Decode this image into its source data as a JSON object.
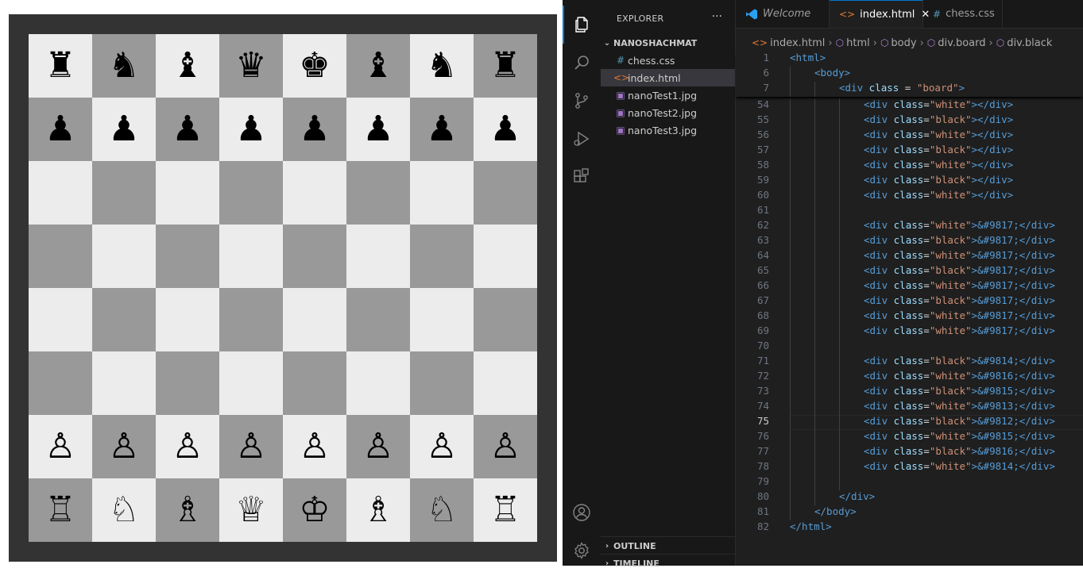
{
  "board": {
    "rows": [
      [
        {
          "p": "♜",
          "c": "white"
        },
        {
          "p": "♞",
          "c": "black"
        },
        {
          "p": "♝",
          "c": "white"
        },
        {
          "p": "♛",
          "c": "black"
        },
        {
          "p": "♚",
          "c": "white"
        },
        {
          "p": "♝",
          "c": "black"
        },
        {
          "p": "♞",
          "c": "white"
        },
        {
          "p": "♜",
          "c": "black"
        }
      ],
      [
        {
          "p": "♟",
          "c": "black"
        },
        {
          "p": "♟",
          "c": "white"
        },
        {
          "p": "♟",
          "c": "black"
        },
        {
          "p": "♟",
          "c": "white"
        },
        {
          "p": "♟",
          "c": "black"
        },
        {
          "p": "♟",
          "c": "white"
        },
        {
          "p": "♟",
          "c": "black"
        },
        {
          "p": "♟",
          "c": "white"
        }
      ],
      [
        {
          "p": "",
          "c": "white"
        },
        {
          "p": "",
          "c": "black"
        },
        {
          "p": "",
          "c": "white"
        },
        {
          "p": "",
          "c": "black"
        },
        {
          "p": "",
          "c": "white"
        },
        {
          "p": "",
          "c": "black"
        },
        {
          "p": "",
          "c": "white"
        },
        {
          "p": "",
          "c": "black"
        }
      ],
      [
        {
          "p": "",
          "c": "black"
        },
        {
          "p": "",
          "c": "white"
        },
        {
          "p": "",
          "c": "black"
        },
        {
          "p": "",
          "c": "white"
        },
        {
          "p": "",
          "c": "black"
        },
        {
          "p": "",
          "c": "white"
        },
        {
          "p": "",
          "c": "black"
        },
        {
          "p": "",
          "c": "white"
        }
      ],
      [
        {
          "p": "",
          "c": "white"
        },
        {
          "p": "",
          "c": "black"
        },
        {
          "p": "",
          "c": "white"
        },
        {
          "p": "",
          "c": "black"
        },
        {
          "p": "",
          "c": "white"
        },
        {
          "p": "",
          "c": "black"
        },
        {
          "p": "",
          "c": "white"
        },
        {
          "p": "",
          "c": "black"
        }
      ],
      [
        {
          "p": "",
          "c": "black"
        },
        {
          "p": "",
          "c": "white"
        },
        {
          "p": "",
          "c": "black"
        },
        {
          "p": "",
          "c": "white"
        },
        {
          "p": "",
          "c": "black"
        },
        {
          "p": "",
          "c": "white"
        },
        {
          "p": "",
          "c": "black"
        },
        {
          "p": "",
          "c": "white"
        }
      ],
      [
        {
          "p": "♙",
          "c": "white"
        },
        {
          "p": "♙",
          "c": "black"
        },
        {
          "p": "♙",
          "c": "white"
        },
        {
          "p": "♙",
          "c": "black"
        },
        {
          "p": "♙",
          "c": "white"
        },
        {
          "p": "♙",
          "c": "black"
        },
        {
          "p": "♙",
          "c": "white"
        },
        {
          "p": "♙",
          "c": "black"
        }
      ],
      [
        {
          "p": "♖",
          "c": "black"
        },
        {
          "p": "♘",
          "c": "white"
        },
        {
          "p": "♗",
          "c": "black"
        },
        {
          "p": "♕",
          "c": "white"
        },
        {
          "p": "♔",
          "c": "black"
        },
        {
          "p": "♗",
          "c": "white"
        },
        {
          "p": "♘",
          "c": "black"
        },
        {
          "p": "♖",
          "c": "white"
        }
      ]
    ]
  },
  "activity_bar": {
    "items": [
      {
        "icon": "files-icon",
        "active": true
      },
      {
        "icon": "search-icon",
        "active": false
      },
      {
        "icon": "source-control-icon",
        "active": false
      },
      {
        "icon": "run-debug-icon",
        "active": false
      },
      {
        "icon": "extensions-icon",
        "active": false
      }
    ],
    "bottom": [
      {
        "icon": "account-icon"
      },
      {
        "icon": "settings-gear-icon"
      }
    ]
  },
  "sidebar": {
    "title": "EXPLORER",
    "more": "···",
    "folder": "NANOSHACHMAT",
    "files": [
      {
        "name": "chess.css",
        "icon": "#",
        "color": "#519aba",
        "selected": false
      },
      {
        "name": "index.html",
        "icon": "<>",
        "color": "#e37933",
        "selected": true
      },
      {
        "name": "nanoTest1.jpg",
        "icon": "▣",
        "color": "#a074c4",
        "selected": false
      },
      {
        "name": "nanoTest2.jpg",
        "icon": "▣",
        "color": "#a074c4",
        "selected": false
      },
      {
        "name": "nanoTest3.jpg",
        "icon": "▣",
        "color": "#a074c4",
        "selected": false
      }
    ],
    "outline": "OUTLINE",
    "timeline": "TIMELINE"
  },
  "tabs": [
    {
      "label": "Welcome",
      "icon": "vscode-logo-icon",
      "active": false,
      "italic": true
    },
    {
      "label": "index.html",
      "icon": "<>",
      "active": true,
      "close": "✕"
    },
    {
      "label": "chess.css",
      "icon": "#",
      "active": false,
      "italic": false
    }
  ],
  "breadcrumb": [
    "index.html",
    "html",
    "body",
    "div.board",
    "div.black"
  ],
  "code": {
    "current_line": 75,
    "sticky": [
      {
        "n": 1,
        "indent": 0,
        "tokens": [
          [
            "tag",
            "<html>"
          ]
        ]
      },
      {
        "n": 6,
        "indent": 1,
        "tokens": [
          [
            "tag",
            "<body>"
          ]
        ]
      },
      {
        "n": 7,
        "indent": 2,
        "tokens": [
          [
            "tag",
            "<div "
          ],
          [
            "attr",
            "class "
          ],
          [
            "txt",
            "= "
          ],
          [
            "str",
            "\"board\""
          ],
          [
            "tag",
            ">"
          ]
        ]
      }
    ],
    "lines": [
      {
        "n": 54,
        "indent": 3,
        "tokens": [
          [
            "tag",
            "<div "
          ],
          [
            "attr",
            "class"
          ],
          [
            "txt",
            "="
          ],
          [
            "str",
            "\"white\""
          ],
          [
            "tag",
            "></div>"
          ]
        ]
      },
      {
        "n": 55,
        "indent": 3,
        "tokens": [
          [
            "tag",
            "<div "
          ],
          [
            "attr",
            "class"
          ],
          [
            "txt",
            "="
          ],
          [
            "str",
            "\"black\""
          ],
          [
            "tag",
            "></div>"
          ]
        ]
      },
      {
        "n": 56,
        "indent": 3,
        "tokens": [
          [
            "tag",
            "<div "
          ],
          [
            "attr",
            "class"
          ],
          [
            "txt",
            "="
          ],
          [
            "str",
            "\"white\""
          ],
          [
            "tag",
            "></div>"
          ]
        ]
      },
      {
        "n": 57,
        "indent": 3,
        "tokens": [
          [
            "tag",
            "<div "
          ],
          [
            "attr",
            "class"
          ],
          [
            "txt",
            "="
          ],
          [
            "str",
            "\"black\""
          ],
          [
            "tag",
            "></div>"
          ]
        ]
      },
      {
        "n": 58,
        "indent": 3,
        "tokens": [
          [
            "tag",
            "<div "
          ],
          [
            "attr",
            "class"
          ],
          [
            "txt",
            "="
          ],
          [
            "str",
            "\"white\""
          ],
          [
            "tag",
            "></div>"
          ]
        ]
      },
      {
        "n": 59,
        "indent": 3,
        "tokens": [
          [
            "tag",
            "<div "
          ],
          [
            "attr",
            "class"
          ],
          [
            "txt",
            "="
          ],
          [
            "str",
            "\"black\""
          ],
          [
            "tag",
            "></div>"
          ]
        ]
      },
      {
        "n": 60,
        "indent": 3,
        "tokens": [
          [
            "tag",
            "<div "
          ],
          [
            "attr",
            "class"
          ],
          [
            "txt",
            "="
          ],
          [
            "str",
            "\"white\""
          ],
          [
            "tag",
            "></div>"
          ]
        ]
      },
      {
        "n": 61,
        "indent": 3,
        "tokens": []
      },
      {
        "n": 62,
        "indent": 3,
        "tokens": [
          [
            "tag",
            "<div "
          ],
          [
            "attr",
            "class"
          ],
          [
            "txt",
            "="
          ],
          [
            "str",
            "\"white\""
          ],
          [
            "tag",
            ">"
          ],
          [
            "ent",
            "&#9817;"
          ],
          [
            "tag",
            "</div>"
          ]
        ]
      },
      {
        "n": 63,
        "indent": 3,
        "tokens": [
          [
            "tag",
            "<div "
          ],
          [
            "attr",
            "class"
          ],
          [
            "txt",
            "="
          ],
          [
            "str",
            "\"black\""
          ],
          [
            "tag",
            ">"
          ],
          [
            "ent",
            "&#9817;"
          ],
          [
            "tag",
            "</div>"
          ]
        ]
      },
      {
        "n": 64,
        "indent": 3,
        "tokens": [
          [
            "tag",
            "<div "
          ],
          [
            "attr",
            "class"
          ],
          [
            "txt",
            "="
          ],
          [
            "str",
            "\"white\""
          ],
          [
            "tag",
            ">"
          ],
          [
            "ent",
            "&#9817;"
          ],
          [
            "tag",
            "</div>"
          ]
        ]
      },
      {
        "n": 65,
        "indent": 3,
        "tokens": [
          [
            "tag",
            "<div "
          ],
          [
            "attr",
            "class"
          ],
          [
            "txt",
            "="
          ],
          [
            "str",
            "\"black\""
          ],
          [
            "tag",
            ">"
          ],
          [
            "ent",
            "&#9817;"
          ],
          [
            "tag",
            "</div>"
          ]
        ]
      },
      {
        "n": 66,
        "indent": 3,
        "tokens": [
          [
            "tag",
            "<div "
          ],
          [
            "attr",
            "class"
          ],
          [
            "txt",
            "="
          ],
          [
            "str",
            "\"white\""
          ],
          [
            "tag",
            ">"
          ],
          [
            "ent",
            "&#9817;"
          ],
          [
            "tag",
            "</div>"
          ]
        ]
      },
      {
        "n": 67,
        "indent": 3,
        "tokens": [
          [
            "tag",
            "<div "
          ],
          [
            "attr",
            "class"
          ],
          [
            "txt",
            "="
          ],
          [
            "str",
            "\"black\""
          ],
          [
            "tag",
            ">"
          ],
          [
            "ent",
            "&#9817;"
          ],
          [
            "tag",
            "</div>"
          ]
        ]
      },
      {
        "n": 68,
        "indent": 3,
        "tokens": [
          [
            "tag",
            "<div "
          ],
          [
            "attr",
            "class"
          ],
          [
            "txt",
            "="
          ],
          [
            "str",
            "\"white\""
          ],
          [
            "tag",
            ">"
          ],
          [
            "ent",
            "&#9817;"
          ],
          [
            "tag",
            "</div>"
          ]
        ]
      },
      {
        "n": 69,
        "indent": 3,
        "tokens": [
          [
            "tag",
            "<div "
          ],
          [
            "attr",
            "class"
          ],
          [
            "txt",
            "="
          ],
          [
            "str",
            "\"white\""
          ],
          [
            "tag",
            ">"
          ],
          [
            "ent",
            "&#9817;"
          ],
          [
            "tag",
            "</div>"
          ]
        ]
      },
      {
        "n": 70,
        "indent": 3,
        "tokens": []
      },
      {
        "n": 71,
        "indent": 3,
        "tokens": [
          [
            "tag",
            "<div "
          ],
          [
            "attr",
            "class"
          ],
          [
            "txt",
            "="
          ],
          [
            "str",
            "\"black\""
          ],
          [
            "tag",
            ">"
          ],
          [
            "ent",
            "&#9814;"
          ],
          [
            "tag",
            "</div>"
          ]
        ]
      },
      {
        "n": 72,
        "indent": 3,
        "tokens": [
          [
            "tag",
            "<div "
          ],
          [
            "attr",
            "class"
          ],
          [
            "txt",
            "="
          ],
          [
            "str",
            "\"white\""
          ],
          [
            "tag",
            ">"
          ],
          [
            "ent",
            "&#9816;"
          ],
          [
            "tag",
            "</div>"
          ]
        ]
      },
      {
        "n": 73,
        "indent": 3,
        "tokens": [
          [
            "tag",
            "<div "
          ],
          [
            "attr",
            "class"
          ],
          [
            "txt",
            "="
          ],
          [
            "str",
            "\"black\""
          ],
          [
            "tag",
            ">"
          ],
          [
            "ent",
            "&#9815;"
          ],
          [
            "tag",
            "</div>"
          ]
        ]
      },
      {
        "n": 74,
        "indent": 3,
        "tokens": [
          [
            "tag",
            "<div "
          ],
          [
            "attr",
            "class"
          ],
          [
            "txt",
            "="
          ],
          [
            "str",
            "\"white\""
          ],
          [
            "tag",
            ">"
          ],
          [
            "ent",
            "&#9813;"
          ],
          [
            "tag",
            "</div>"
          ]
        ]
      },
      {
        "n": 75,
        "indent": 3,
        "tokens": [
          [
            "tag",
            "<div "
          ],
          [
            "attr",
            "class"
          ],
          [
            "txt",
            "="
          ],
          [
            "str",
            "\"black\""
          ],
          [
            "tag",
            ">"
          ],
          [
            "ent",
            "&#9812;"
          ],
          [
            "tag",
            "</div>"
          ]
        ]
      },
      {
        "n": 76,
        "indent": 3,
        "tokens": [
          [
            "tag",
            "<div "
          ],
          [
            "attr",
            "class"
          ],
          [
            "txt",
            "="
          ],
          [
            "str",
            "\"white\""
          ],
          [
            "tag",
            ">"
          ],
          [
            "ent",
            "&#9815;"
          ],
          [
            "tag",
            "</div>"
          ]
        ]
      },
      {
        "n": 77,
        "indent": 3,
        "tokens": [
          [
            "tag",
            "<div "
          ],
          [
            "attr",
            "class"
          ],
          [
            "txt",
            "="
          ],
          [
            "str",
            "\"black\""
          ],
          [
            "tag",
            ">"
          ],
          [
            "ent",
            "&#9816;"
          ],
          [
            "tag",
            "</div>"
          ]
        ]
      },
      {
        "n": 78,
        "indent": 3,
        "tokens": [
          [
            "tag",
            "<div "
          ],
          [
            "attr",
            "class"
          ],
          [
            "txt",
            "="
          ],
          [
            "str",
            "\"white\""
          ],
          [
            "tag",
            ">"
          ],
          [
            "ent",
            "&#9814;"
          ],
          [
            "tag",
            "</div>"
          ]
        ]
      },
      {
        "n": 79,
        "indent": 3,
        "tokens": []
      },
      {
        "n": 80,
        "indent": 2,
        "tokens": [
          [
            "tag",
            "</div>"
          ]
        ]
      },
      {
        "n": 81,
        "indent": 1,
        "tokens": [
          [
            "tag",
            "</body>"
          ]
        ]
      },
      {
        "n": 82,
        "indent": 0,
        "tokens": [
          [
            "tag",
            "</html>"
          ]
        ]
      }
    ]
  }
}
